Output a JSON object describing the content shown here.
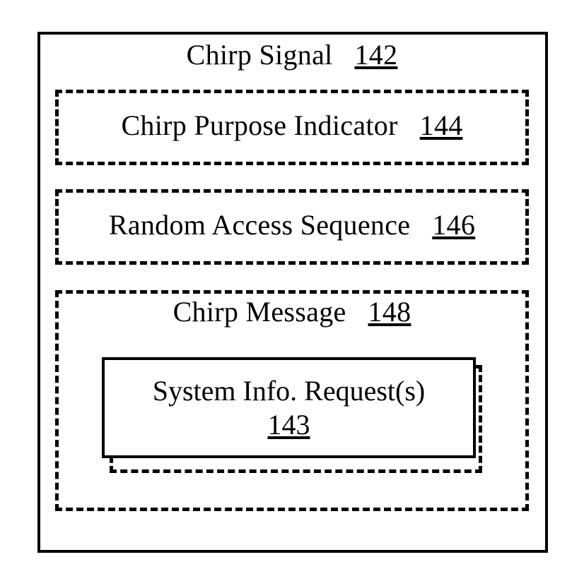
{
  "figure": {
    "type": "patent-block-diagram",
    "description": "Nested block diagram of a chirp signal structure"
  },
  "outer_block": {
    "name": "Chirp Signal",
    "label_text": "Chirp Signal",
    "reference_number": "142",
    "border_style": "solid",
    "color": "#000000"
  },
  "sub_blocks": [
    {
      "name": "Chirp Purpose Indicator",
      "label_text": "Chirp Purpose Indicator",
      "reference_number": "144",
      "border_style": "dashed"
    },
    {
      "name": "Random Access Sequence",
      "label_text": "Random Access Sequence",
      "reference_number": "146",
      "border_style": "dashed"
    },
    {
      "name": "Chirp Message",
      "label_text": "Chirp Message",
      "reference_number": "148",
      "border_style": "dashed"
    }
  ],
  "inner_block": {
    "name": "System Info. Request(s)",
    "label_text": "System Info. Request(s)",
    "reference_number": "143",
    "border_style": "solid",
    "backing_box_style": "dashed"
  }
}
